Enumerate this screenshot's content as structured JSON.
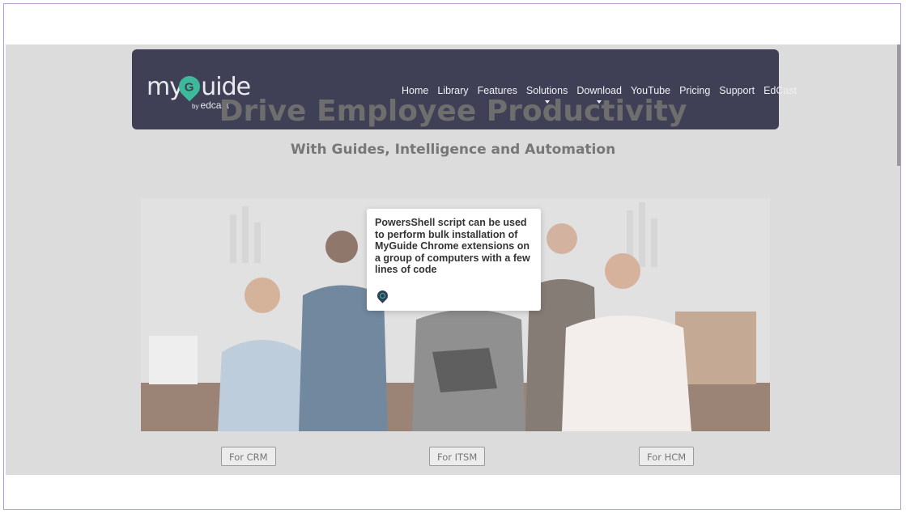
{
  "brand": {
    "logo_word_prefix": "my",
    "logo_word_g": "G",
    "logo_word_suffix": "uide",
    "logo_by": "by",
    "logo_company": "edcast"
  },
  "nav": {
    "items": [
      {
        "label": "Home",
        "has_dropdown": false
      },
      {
        "label": "Library",
        "has_dropdown": false
      },
      {
        "label": "Features",
        "has_dropdown": false
      },
      {
        "label": "Solutions",
        "has_dropdown": true
      },
      {
        "label": "Download",
        "has_dropdown": true
      },
      {
        "label": "YouTube",
        "has_dropdown": false
      },
      {
        "label": "Pricing",
        "has_dropdown": false
      },
      {
        "label": "Support",
        "has_dropdown": false
      },
      {
        "label": "EdCast",
        "has_dropdown": false
      }
    ]
  },
  "hero": {
    "title": "Drive Employee Productivity",
    "subtitle": "With Guides, Intelligence and Automation"
  },
  "cta": {
    "crm": "For CRM",
    "itsm": "For ITSM",
    "hcm": "For HCM"
  },
  "tooltip": {
    "text": "PowersShell script can be used to perform bulk installation of MyGuide Chrome extensions on a group of computers with a few lines of code"
  },
  "colors": {
    "navbar": "#3f3f55",
    "accent": "#3db99c",
    "overlay_bg": "#dcdcdc"
  }
}
